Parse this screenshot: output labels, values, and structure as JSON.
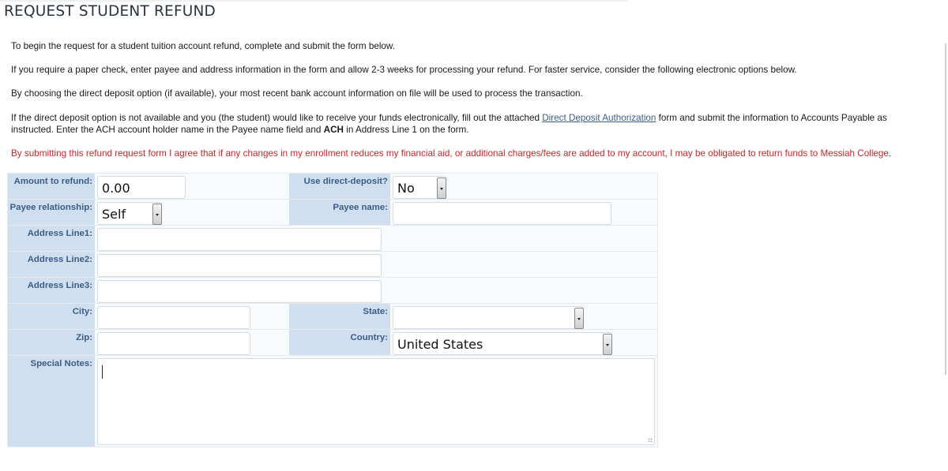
{
  "page": {
    "title": "REQUEST STUDENT REFUND"
  },
  "intro": {
    "p1": "To begin the request for a student tuition account refund, complete and submit the form below.",
    "p2": "If you require a paper check, enter payee and address information in the form and allow 2-3 weeks for processing your refund. For faster service, consider the following electronic options below.",
    "p3": "By choosing the direct deposit option (if available), your most recent bank account information on file will be used to process the transaction.",
    "p4_before_link": "If the direct deposit option is not available and you (the student) would like to receive your funds electronically, fill out the attached ",
    "p4_link": "Direct Deposit Authorization",
    "p4_after_link": " form and submit the information to Accounts Payable as instructed. Enter the ACH account holder name in the Payee name field and ",
    "p4_bold": "ACH",
    "p4_end": " in Address Line 1 on the form.",
    "p5": "By submitting this refund request form I agree that if any changes in my enrollment reduces my financial aid, or additional charges/fees are added to my account, I may be obligated to return funds to Messiah College."
  },
  "form": {
    "amount": {
      "label": "Amount to refund:",
      "value": "0.00"
    },
    "direct_deposit": {
      "label": "Use direct-deposit?",
      "value": "No"
    },
    "payee_relationship": {
      "label": "Payee relationship:",
      "value": "Self"
    },
    "payee_name": {
      "label": "Payee name:",
      "value": ""
    },
    "address1": {
      "label": "Address Line1:",
      "value": ""
    },
    "address2": {
      "label": "Address Line2:",
      "value": ""
    },
    "address3": {
      "label": "Address Line3:",
      "value": ""
    },
    "city": {
      "label": "City:",
      "value": ""
    },
    "state": {
      "label": "State:",
      "value": ""
    },
    "zip": {
      "label": "Zip:",
      "value": ""
    },
    "country": {
      "label": "Country:",
      "value": "United States"
    },
    "notes": {
      "label": "Special Notes:",
      "value": ""
    }
  },
  "colors": {
    "label_bg": "#cfdff0",
    "label_text": "#3c5d85",
    "warning_text": "#d4202a",
    "link": "#3a5f8a"
  }
}
